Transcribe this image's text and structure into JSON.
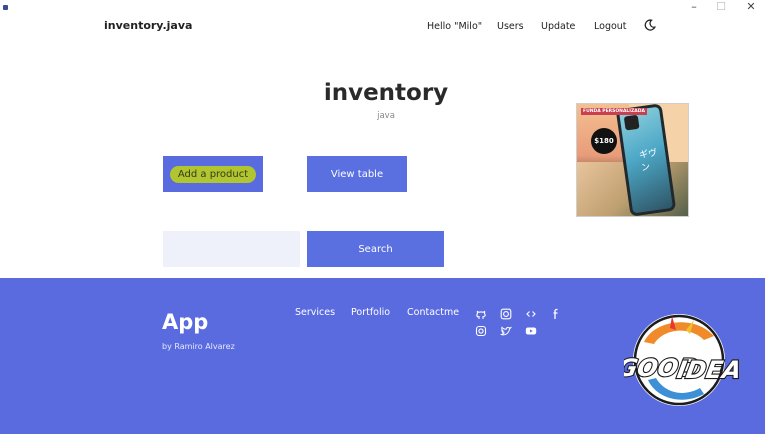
{
  "window": {
    "minimize_glyph": "–",
    "maximize_glyph": "☐",
    "close_glyph": "✕"
  },
  "navbar": {
    "brand": "inventory.java",
    "greeting": "Hello \"Milo\"",
    "items": [
      "Users",
      "Update",
      "Logout"
    ],
    "theme_icon": "moon-icon"
  },
  "main": {
    "title": "inventory",
    "subtitle": "java",
    "add_button": "Add a product",
    "view_button": "View table",
    "search_button": "Search",
    "search_placeholder": ""
  },
  "product_image": {
    "label": "FUNDA PERSONALIZADA",
    "price": "$180",
    "kana": "ギヴン"
  },
  "footer": {
    "app_name": "App",
    "byline": "by Ramiro Alvarez",
    "links": [
      "Services",
      "Portfolio",
      "Contactme"
    ],
    "social_icons": [
      "github-icon",
      "codepen-icon",
      "code-icon",
      "facebook-icon",
      "instagram-icon",
      "twitter-icon",
      "youtube-icon"
    ]
  },
  "logo": {
    "text": "GOOD IDEA"
  },
  "colors": {
    "accent": "#5a6be0",
    "input_bg": "#eef1f9",
    "highlight": "#b9cf1c"
  }
}
